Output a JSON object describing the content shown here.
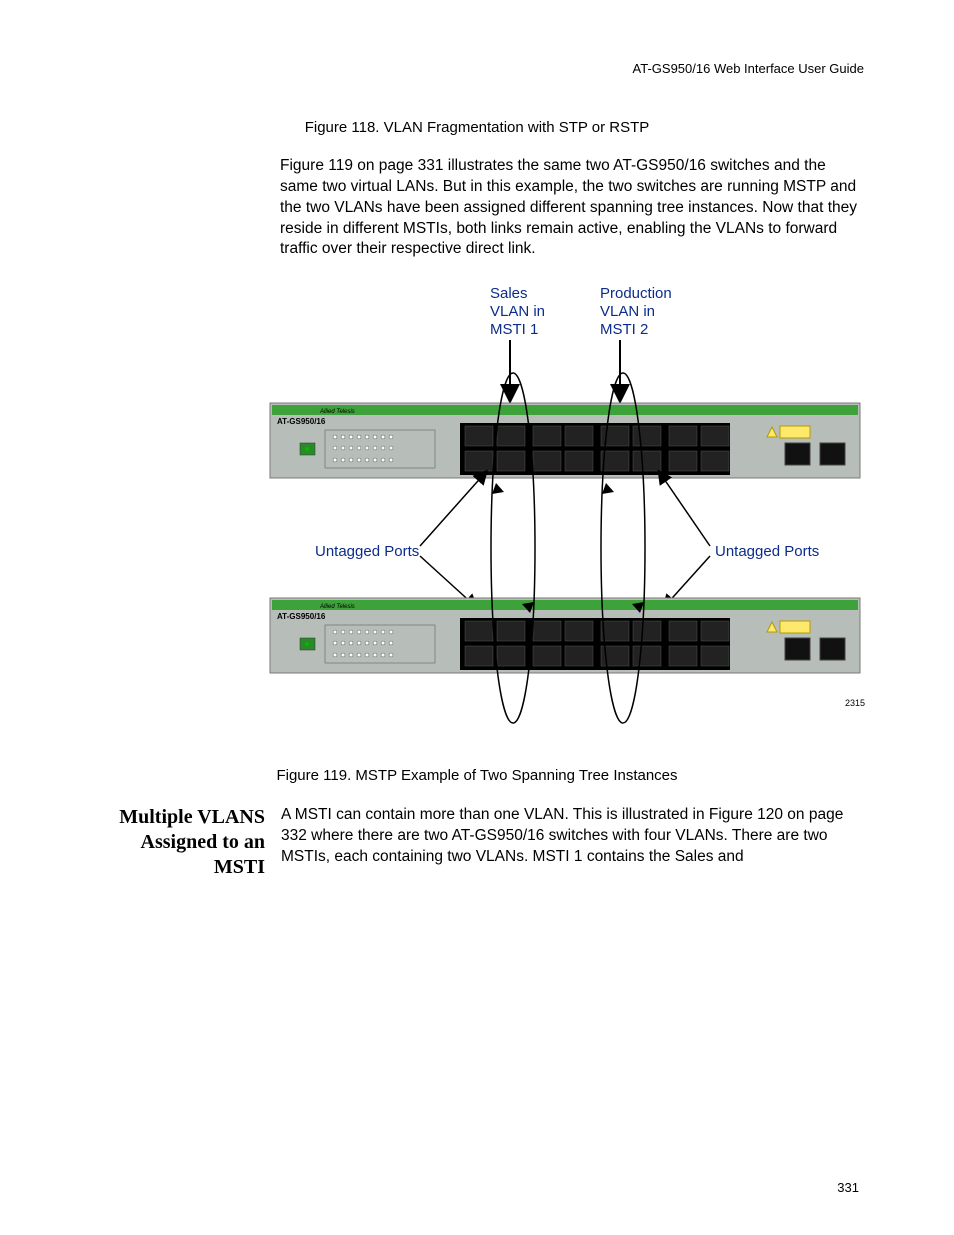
{
  "header": {
    "running_head": "AT-GS950/16  Web Interface User Guide"
  },
  "captions": {
    "fig118": "Figure 118. VLAN Fragmentation with STP or RSTP",
    "fig119": "Figure 119. MSTP Example of Two Spanning Tree Instances"
  },
  "paragraphs": {
    "p1": "Figure 119 on page 331 illustrates the same two AT-GS950/16 switches and the same two virtual LANs. But in this example, the two switches are running MSTP and the two VLANs have been assigned different spanning tree instances. Now that they reside in different MSTIs, both links remain active, enabling the VLANs to forward traffic over their respective direct link."
  },
  "diagram": {
    "label_sales_l1": "Sales",
    "label_sales_l2": "VLAN in",
    "label_sales_l3": "MSTI 1",
    "label_prod_l1": "Production",
    "label_prod_l2": "VLAN in",
    "label_prod_l3": "MSTI 2",
    "label_untagged": "Untagged Ports",
    "switch_model": "AT-GS950/16",
    "brand": "Allied Telesis",
    "figure_id": "2315"
  },
  "section": {
    "side_heading": "Multiple VLANS Assigned to an MSTI",
    "body": "A MSTI can contain more than one VLAN. This is illustrated in Figure 120 on page 332 where there are two AT-GS950/16 switches with four VLANs. There are two MSTIs, each containing two VLANs. MSTI 1 contains the Sales and"
  },
  "page_number": "331"
}
